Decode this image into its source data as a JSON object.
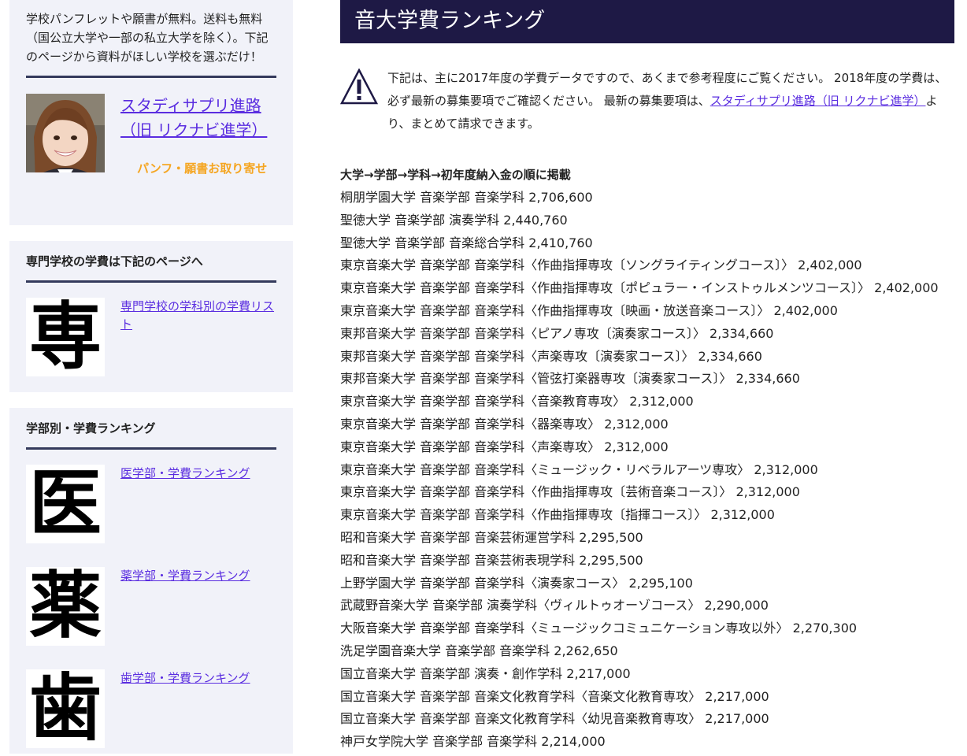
{
  "sidebar": {
    "promo": {
      "intro": "学校パンフレットや願書が無料。送料も無料（国公立大学や一部の私立大学を除く）。下記のページから資料がほしい学校を選ぶだけ！",
      "link": "スタディサプリ進路（旧 リクナビ進学）",
      "cta": "パンフ・願書お取り寄せ"
    },
    "vocational": {
      "title": "専門学校の学費は下記のページへ",
      "icon_char": "専",
      "link": "専門学校の学科別の学費リスト"
    },
    "ranking": {
      "title": "学部別・学費ランキング",
      "items": [
        {
          "icon_char": "医",
          "link": "医学部・学費ランキング"
        },
        {
          "icon_char": "薬",
          "link": "薬学部・学費ランキング"
        },
        {
          "icon_char": "歯",
          "link": "歯学部・学費ランキング"
        }
      ]
    }
  },
  "main": {
    "title": "音大学費ランキング",
    "notice": {
      "text_before": "下記は、主に2017年度の学費データですので、あくまで参考程度にご覧ください。 2018年度の学費は、必ず最新の募集要項でご確認ください。 最新の募集要項は、",
      "link": "スタディサプリ進路（旧 リクナビ進学）",
      "text_after": "より、まとめて請求できます。"
    },
    "list_heading": "大学→学部→学科→初年度納入金の順に掲載",
    "rows": [
      "桐朋学園大学 音楽学部 音楽学科 2,706,600",
      "聖徳大学 音楽学部 演奏学科 2,440,760",
      "聖徳大学 音楽学部 音楽総合学科 2,410,760",
      "東京音楽大学 音楽学部 音楽学科〈作曲指揮専攻〔ソングライティングコース〕〉 2,402,000",
      "東京音楽大学 音楽学部 音楽学科〈作曲指揮専攻〔ポピュラー・インストゥルメンツコース〕〉 2,402,000",
      "東京音楽大学 音楽学部 音楽学科〈作曲指揮専攻〔映画・放送音楽コース〕〉 2,402,000",
      "東邦音楽大学 音楽学部 音楽学科〈ピアノ専攻〔演奏家コース〕〉 2,334,660",
      "東邦音楽大学 音楽学部 音楽学科〈声楽専攻〔演奏家コース〕〉 2,334,660",
      "東邦音楽大学 音楽学部 音楽学科〈管弦打楽器専攻〔演奏家コース〕〉 2,334,660",
      "東京音楽大学 音楽学部 音楽学科〈音楽教育専攻〉 2,312,000",
      "東京音楽大学 音楽学部 音楽学科〈器楽専攻〉 2,312,000",
      "東京音楽大学 音楽学部 音楽学科〈声楽専攻〉 2,312,000",
      "東京音楽大学 音楽学部 音楽学科〈ミュージック・リベラルアーツ専攻〉 2,312,000",
      "東京音楽大学 音楽学部 音楽学科〈作曲指揮専攻〔芸術音楽コース〕〉 2,312,000",
      "東京音楽大学 音楽学部 音楽学科〈作曲指揮専攻〔指揮コース〕〉 2,312,000",
      "昭和音楽大学 音楽学部 音楽芸術運営学科 2,295,500",
      "昭和音楽大学 音楽学部 音楽芸術表現学科 2,295,500",
      "上野学園大学 音楽学部 音楽学科〈演奏家コース〉 2,295,100",
      "武蔵野音楽大学 音楽学部 演奏学科〈ヴィルトゥオーゾコース〉 2,290,000",
      "大阪音楽大学 音楽学部 音楽学科〈ミュージックコミュニケーション専攻以外〉 2,270,300",
      "洗足学園音楽大学 音楽学部 音楽学科 2,262,650",
      "国立音楽大学 音楽学部 演奏・創作学科 2,217,000",
      "国立音楽大学 音楽学部 音楽文化教育学科〈音楽文化教育専攻〉 2,217,000",
      "国立音楽大学 音楽学部 音楽文化教育学科〈幼児音楽教育専攻〉 2,217,000",
      "神戸女学院大学 音楽学部 音楽学科 2,214,000"
    ]
  },
  "colors": {
    "title_bar": "#1e1945",
    "sidebar_bg": "#f1f2f9",
    "link": "#5a2de0",
    "cta": "#f5a623"
  }
}
